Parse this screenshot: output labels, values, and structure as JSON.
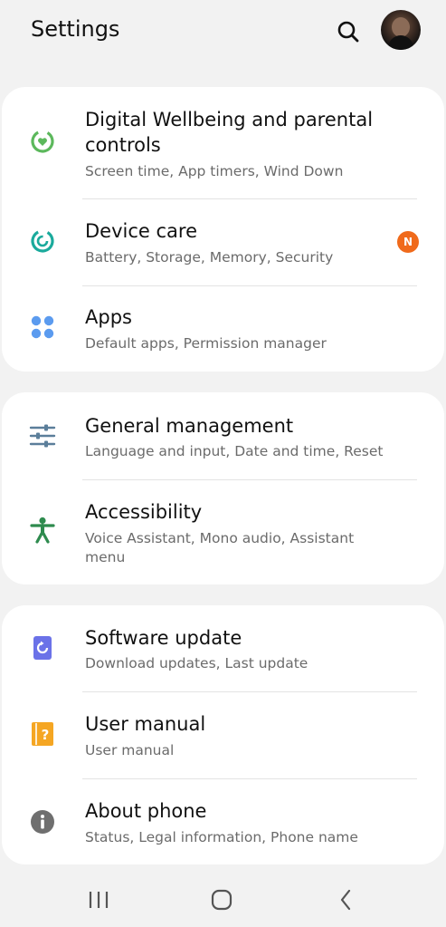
{
  "header": {
    "title": "Settings",
    "search_icon": "search-icon",
    "avatar": "profile-avatar"
  },
  "groups": [
    {
      "items": [
        {
          "label_line1": "Digital Wellbeing and parental",
          "label_line2": "controls",
          "subtitle": "Screen time, App timers, Wind Down",
          "icon": "digital-wellbeing-icon",
          "icon_color": "#5cb85c"
        },
        {
          "label": "Device care",
          "subtitle": "Battery, Storage, Memory, Security",
          "icon": "device-care-icon",
          "icon_color": "#1aaa9c",
          "badge": "N",
          "badge_color": "#f06a1b"
        },
        {
          "label": "Apps",
          "subtitle": "Default apps, Permission manager",
          "icon": "apps-icon",
          "icon_color": "#5b9bef"
        }
      ]
    },
    {
      "items": [
        {
          "label": "General management",
          "subtitle": "Language and input, Date and time, Reset",
          "icon": "sliders-icon",
          "icon_color": "#5b7e9a"
        },
        {
          "label": "Accessibility",
          "subtitle_line1": "Voice Assistant, Mono audio, Assistant",
          "subtitle_line2": "menu",
          "icon": "accessibility-icon",
          "icon_color": "#2e8b4e"
        }
      ]
    },
    {
      "items": [
        {
          "label": "Software update",
          "subtitle": "Download updates, Last update",
          "icon": "software-update-icon",
          "icon_color": "#6b72e8"
        },
        {
          "label": "User manual",
          "subtitle": "User manual",
          "icon": "user-manual-icon",
          "icon_color": "#f5a623"
        },
        {
          "label": "About phone",
          "subtitle": "Status, Legal information, Phone name",
          "icon": "info-icon",
          "icon_color": "#6f6f6f"
        }
      ]
    }
  ],
  "navbar": {
    "recent_icon": "recent-apps-icon",
    "home_icon": "home-icon",
    "back_icon": "back-icon"
  }
}
